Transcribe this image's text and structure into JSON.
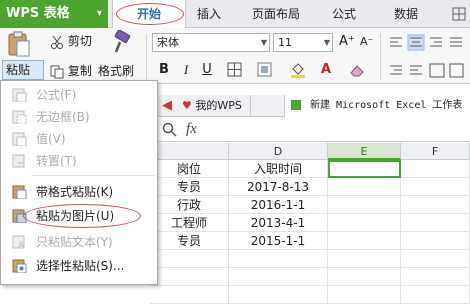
{
  "app": {
    "title": "WPS 表格"
  },
  "ribbon_tabs": [
    "开始",
    "插入",
    "页面布局",
    "公式",
    "数据"
  ],
  "ribbon": {
    "paste_label": "粘贴",
    "cut_label": "剪切",
    "copy_label": "复制",
    "format_painter_label": "格式刷",
    "font_name": "宋体",
    "font_size": "11",
    "bold": "B",
    "italic": "I",
    "underline": "U",
    "grow_font": "A⁺",
    "shrink_font": "A⁻",
    "font_color_letter": "A"
  },
  "doc_tabs": [
    {
      "label": "我的WPS"
    },
    {
      "label": "新建 Microsoft Excel 工作表"
    }
  ],
  "formula_bar": {
    "fx": "fx"
  },
  "columns": [
    "D",
    "E",
    "F"
  ],
  "cells": [
    [
      "岗位",
      "入职时间"
    ],
    [
      "专员",
      "2017-8-13"
    ],
    [
      "行政",
      "2016-1-1"
    ],
    [
      "工程师",
      "2013-4-1"
    ],
    [
      "专员",
      "2015-1-1"
    ]
  ],
  "paste_menu": {
    "items": [
      {
        "label": "公式(F)",
        "enabled": false
      },
      {
        "label": "无边框(B)",
        "enabled": false
      },
      {
        "label": "值(V)",
        "enabled": false
      },
      {
        "label": "转置(T)",
        "enabled": false
      },
      {
        "label": "带格式粘贴(K)",
        "enabled": true
      },
      {
        "label": "粘贴为图片(U)",
        "enabled": true
      },
      {
        "label": "只粘贴文本(Y)",
        "enabled": false
      },
      {
        "label": "选择性粘贴(S)...",
        "enabled": true
      }
    ]
  },
  "colors": {
    "accent": "#4aa42d",
    "highlight_oval": "#d84a4a",
    "disabled_text": "#a8abb0"
  }
}
